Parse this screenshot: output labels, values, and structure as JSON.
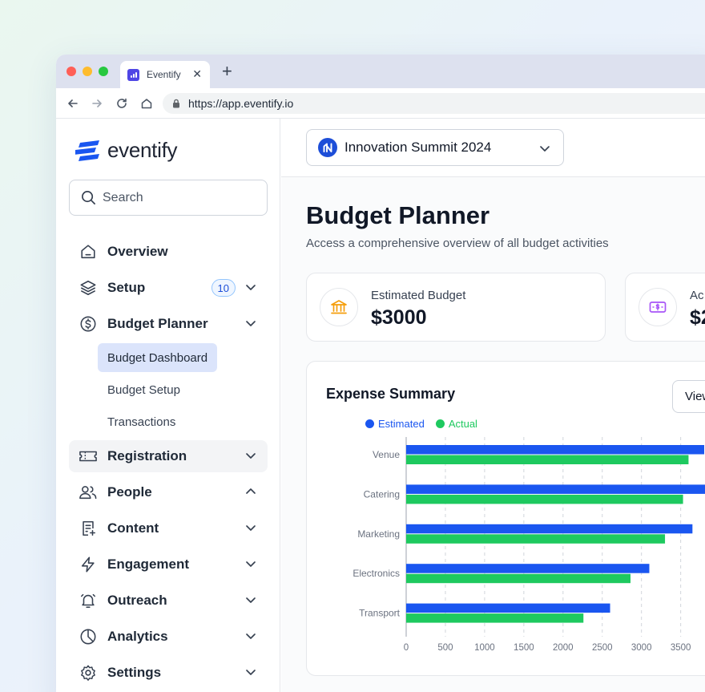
{
  "browser": {
    "tab_title": "Eventify",
    "url": "https://app.eventify.io"
  },
  "sidebar": {
    "logo_text": "eventify",
    "search_placeholder": "Search",
    "items": [
      {
        "label": "Overview",
        "icon": "home-icon"
      },
      {
        "label": "Setup",
        "icon": "layers-icon",
        "badge": "10"
      },
      {
        "label": "Budget Planner",
        "icon": "dollar-circle-icon"
      },
      {
        "label": "Registration",
        "icon": "ticket-icon"
      },
      {
        "label": "People",
        "icon": "users-icon"
      },
      {
        "label": "Content",
        "icon": "document-add-icon"
      },
      {
        "label": "Engagement",
        "icon": "lightning-icon"
      },
      {
        "label": "Outreach",
        "icon": "bell-icon"
      },
      {
        "label": "Analytics",
        "icon": "pie-chart-icon"
      },
      {
        "label": "Settings",
        "icon": "gear-icon"
      }
    ],
    "budget_sub_items": [
      "Budget Dashboard",
      "Budget Setup",
      "Transactions"
    ]
  },
  "header": {
    "event_name": "Innovation Summit 2024"
  },
  "page": {
    "title": "Budget Planner",
    "subtitle": "Access a comprehensive overview of all budget activities"
  },
  "stats": [
    {
      "label": "Estimated Budget",
      "value": "$3000",
      "icon": "bank-icon",
      "color": "#f59e0b"
    },
    {
      "label": "Ac",
      "value": "$2",
      "icon": "cash-icon",
      "color": "#a855f7"
    }
  ],
  "expense_summary": {
    "title": "Expense Summary",
    "view_button": "View"
  },
  "colors": {
    "primary": "#1d4ed8",
    "estimated": "#1a56f0",
    "actual": "#1ec95f"
  },
  "chart_data": {
    "type": "bar",
    "orientation": "horizontal",
    "categories": [
      "Venue",
      "Catering",
      "Marketing",
      "Electronics",
      "Transport"
    ],
    "series": [
      {
        "name": "Estimated",
        "values": [
          3800,
          3900,
          3650,
          3100,
          2600
        ]
      },
      {
        "name": "Actual",
        "values": [
          3600,
          3530,
          3300,
          2860,
          2260
        ]
      }
    ],
    "x_ticks": [
      "0",
      "500",
      "1000",
      "1500",
      "2000",
      "2500",
      "3000",
      "3500"
    ],
    "xlim": [
      0,
      3500
    ],
    "grid": "vertical-dashed",
    "legend": "top-left"
  }
}
